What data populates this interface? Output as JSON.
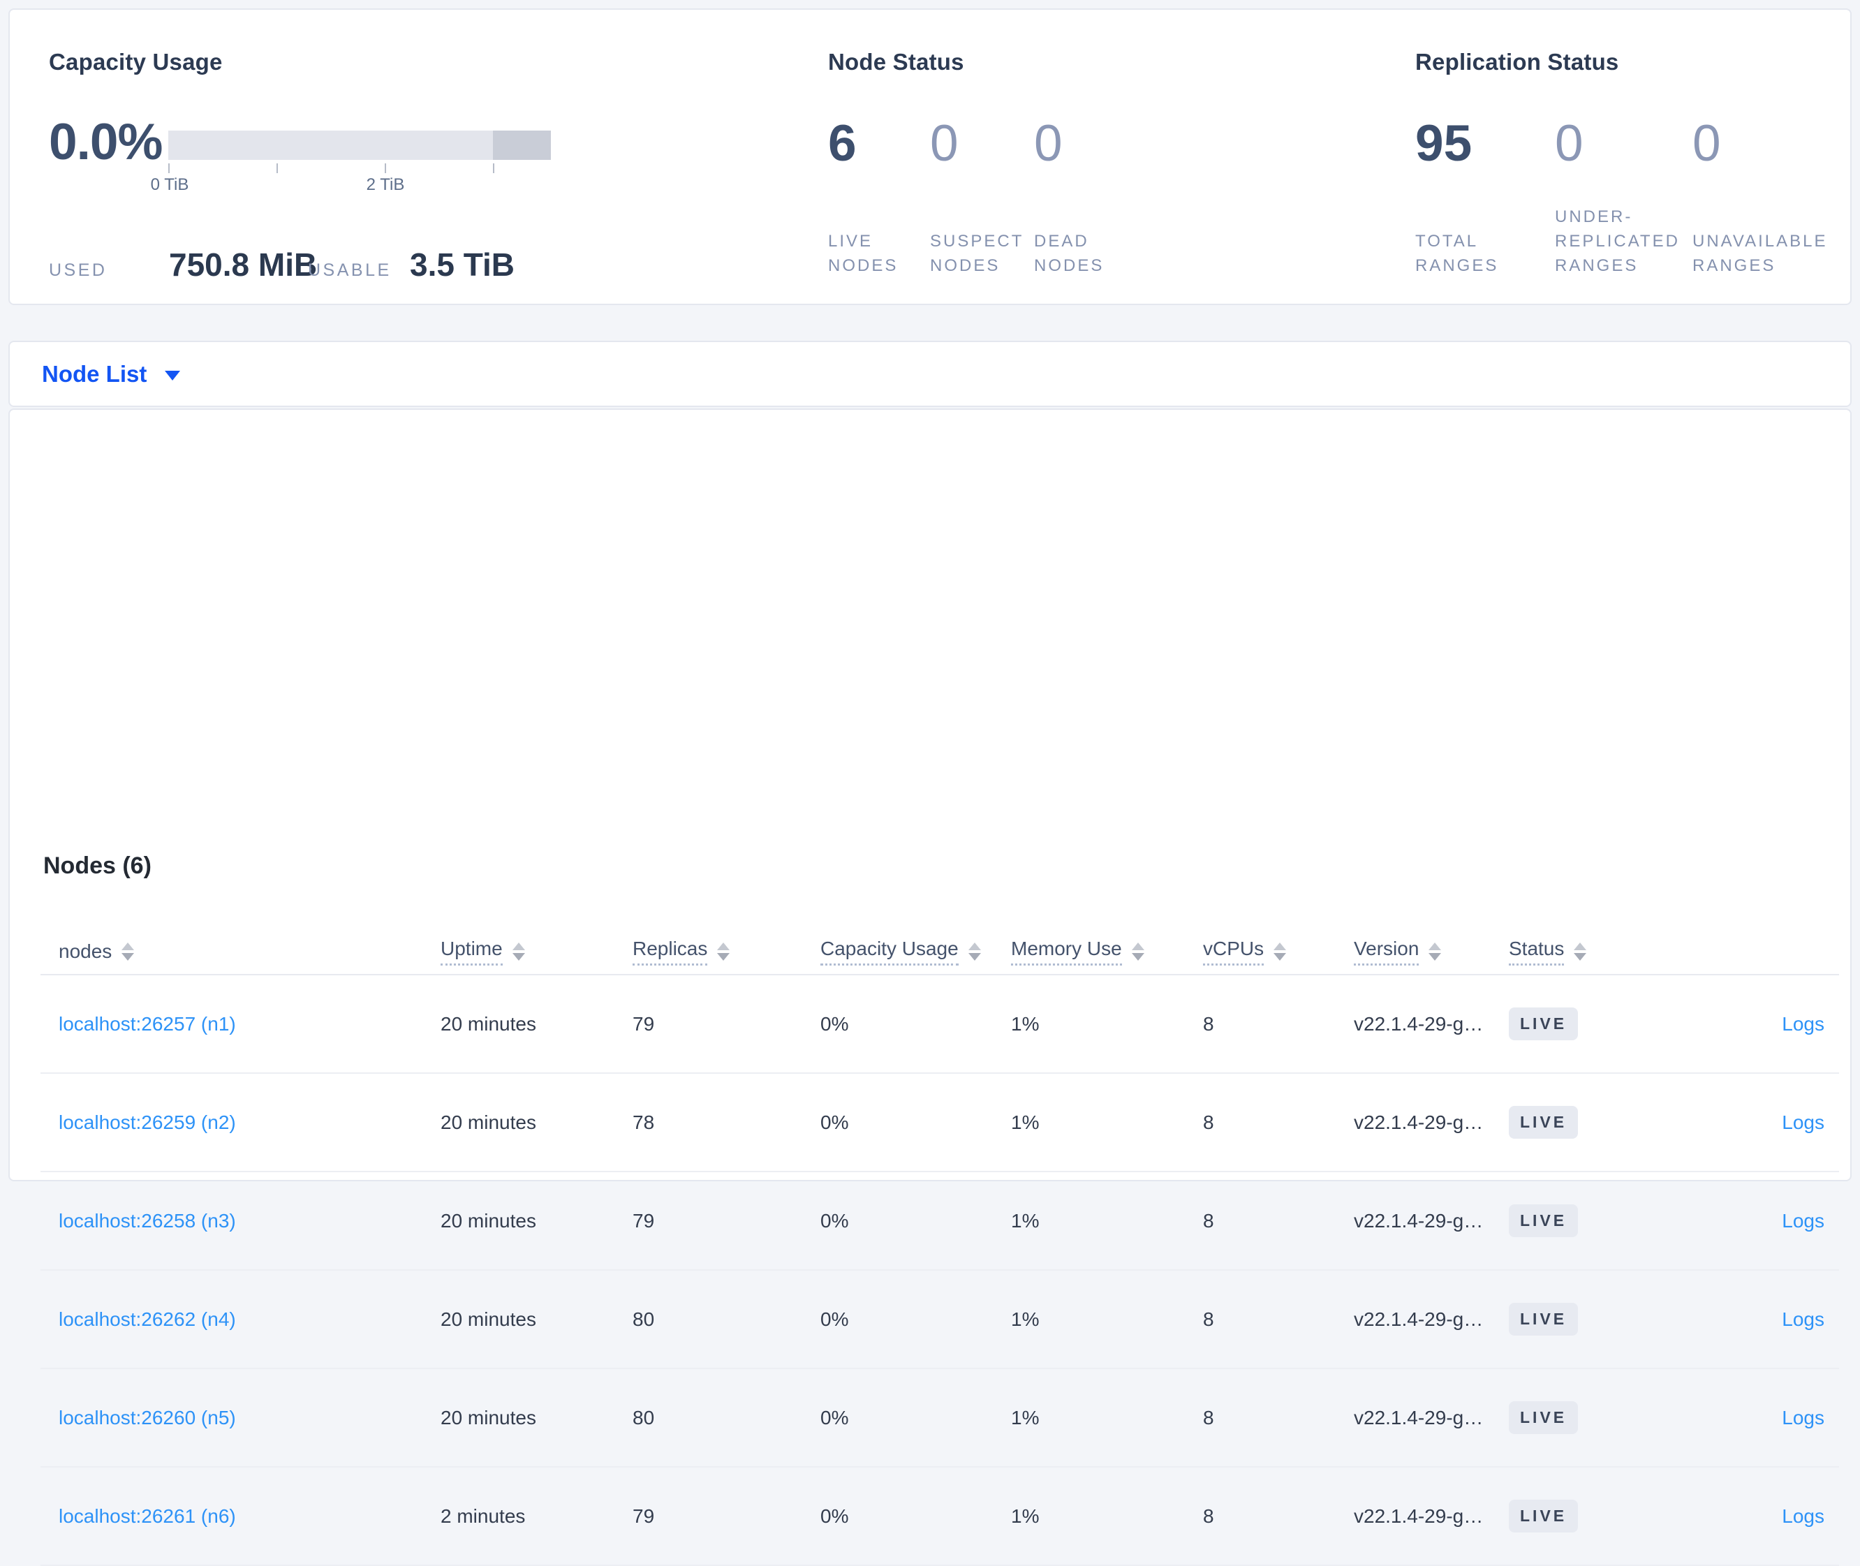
{
  "colors": {
    "page_bg": "#f3f5f9",
    "card_border": "#e4e7ef",
    "dropdown_blue": "#1355f3",
    "link_blue": "#2d92f7",
    "stat_strong": "#3d4f6d",
    "stat_muted": "#8b97b5",
    "badge_bg": "#e7eaf1",
    "meter_light": "#e3e5ec",
    "meter_dark": "#c9cdd7"
  },
  "capacity": {
    "title": "Capacity Usage",
    "percent_used": "0.0%",
    "meter": {
      "tick_labels": [
        "0 TiB",
        "2 TiB"
      ],
      "tail_fraction": 0.152
    },
    "used_label": "USED",
    "used_value": "750.8 MiB",
    "usable_label": "USABLE",
    "usable_value": "3.5 TiB"
  },
  "node_status": {
    "title": "Node Status",
    "stats": [
      {
        "value": "6",
        "label": "LIVE NODES"
      },
      {
        "value": "0",
        "label": "SUSPECT NODES"
      },
      {
        "value": "0",
        "label": "DEAD NODES"
      }
    ]
  },
  "replication_status": {
    "title": "Replication Status",
    "stats": [
      {
        "value": "95",
        "label": "TOTAL RANGES"
      },
      {
        "value": "0",
        "label": "UNDER-REPLICATED RANGES"
      },
      {
        "value": "0",
        "label": "UNAVAILABLE RANGES"
      }
    ]
  },
  "node_list_dropdown": {
    "label": "Node List"
  },
  "nodes_table": {
    "heading": "Nodes (6)",
    "columns": [
      {
        "label": "nodes",
        "tooltip_underline": false
      },
      {
        "label": "Uptime",
        "tooltip_underline": true
      },
      {
        "label": "Replicas",
        "tooltip_underline": true
      },
      {
        "label": "Capacity Usage",
        "tooltip_underline": true
      },
      {
        "label": "Memory Use",
        "tooltip_underline": true
      },
      {
        "label": "vCPUs",
        "tooltip_underline": true
      },
      {
        "label": "Version",
        "tooltip_underline": true
      },
      {
        "label": "Status",
        "tooltip_underline": true
      }
    ],
    "rows": [
      {
        "node": "localhost:26257 (n1)",
        "uptime": "20 minutes",
        "replicas": "79",
        "capacity_usage": "0%",
        "memory_use": "1%",
        "vcpus": "8",
        "version": "v22.1.4-29-g…",
        "status": "LIVE",
        "logs": "Logs"
      },
      {
        "node": "localhost:26259 (n2)",
        "uptime": "20 minutes",
        "replicas": "78",
        "capacity_usage": "0%",
        "memory_use": "1%",
        "vcpus": "8",
        "version": "v22.1.4-29-g…",
        "status": "LIVE",
        "logs": "Logs"
      },
      {
        "node": "localhost:26258 (n3)",
        "uptime": "20 minutes",
        "replicas": "79",
        "capacity_usage": "0%",
        "memory_use": "1%",
        "vcpus": "8",
        "version": "v22.1.4-29-g…",
        "status": "LIVE",
        "logs": "Logs"
      },
      {
        "node": "localhost:26262 (n4)",
        "uptime": "20 minutes",
        "replicas": "80",
        "capacity_usage": "0%",
        "memory_use": "1%",
        "vcpus": "8",
        "version": "v22.1.4-29-g…",
        "status": "LIVE",
        "logs": "Logs"
      },
      {
        "node": "localhost:26260 (n5)",
        "uptime": "20 minutes",
        "replicas": "80",
        "capacity_usage": "0%",
        "memory_use": "1%",
        "vcpus": "8",
        "version": "v22.1.4-29-g…",
        "status": "LIVE",
        "logs": "Logs"
      },
      {
        "node": "localhost:26261 (n6)",
        "uptime": "2 minutes",
        "replicas": "79",
        "capacity_usage": "0%",
        "memory_use": "1%",
        "vcpus": "8",
        "version": "v22.1.4-29-g…",
        "status": "LIVE",
        "logs": "Logs"
      }
    ]
  }
}
